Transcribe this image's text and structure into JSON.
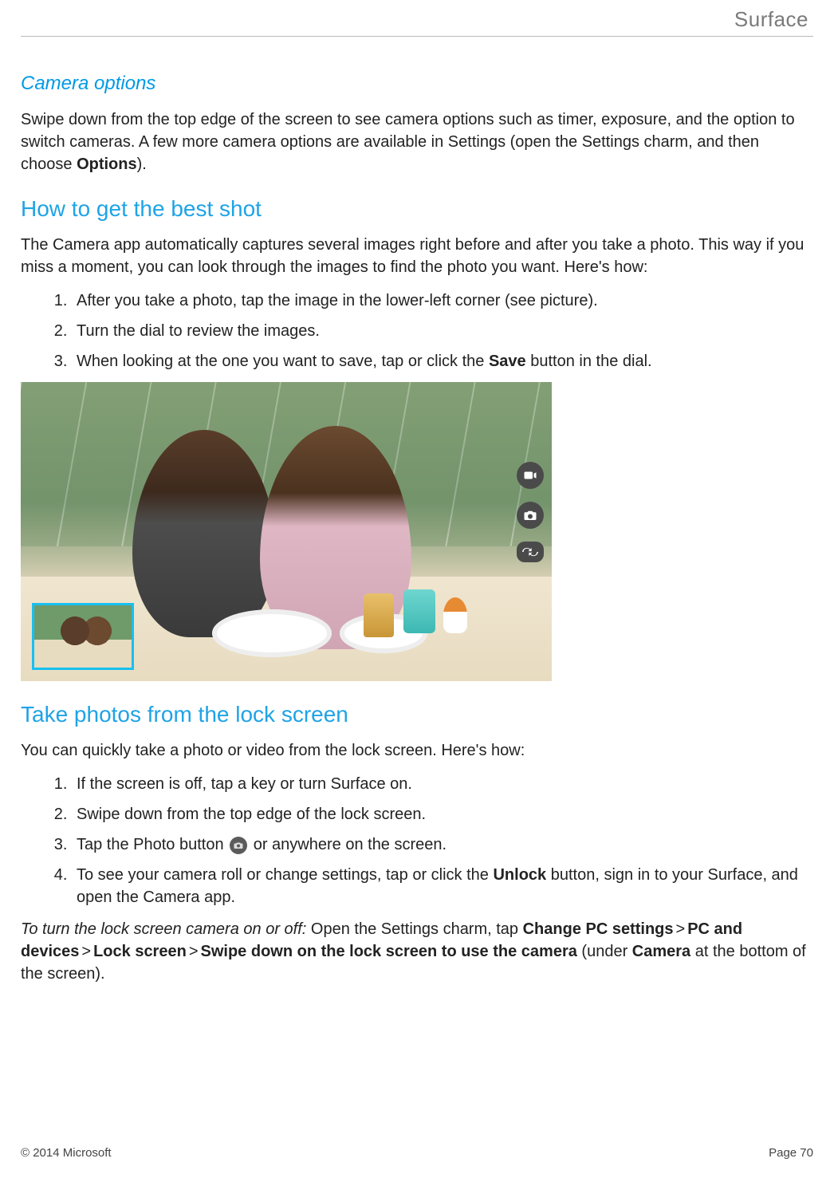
{
  "brand": "Surface",
  "section_camera_options": {
    "title": "Camera options",
    "p1_a": "Swipe down from the top edge of the screen to see camera options such as timer, exposure, and the option to switch cameras. A few more camera options are available in Settings (open the Settings charm, and then choose ",
    "p1_bold": "Options",
    "p1_b": ")."
  },
  "section_best_shot": {
    "title": "How to get the best shot",
    "intro": "The Camera app automatically captures several images right before and after you take a photo. This way if you miss a moment, you can look through the images to find the photo you want. Here's how:",
    "steps": [
      "After you take a photo, tap the image in the lower-left corner (see picture).",
      "Turn the dial to review the images."
    ],
    "step3_a": "When looking at the one you want to save, tap or click the ",
    "step3_bold": "Save",
    "step3_b": " button in the dial."
  },
  "section_lock_screen": {
    "title": "Take photos from the lock screen",
    "intro": "You can quickly take a photo or video from the lock screen. Here's how:",
    "step1": "If the screen is off, tap a key or turn Surface on.",
    "step2": "Swipe down from the top edge of the lock screen.",
    "step3_a": "Tap the Photo button ",
    "step3_b": " or anywhere on the screen.",
    "step4_a": "To see your camera roll or change settings, tap or click the ",
    "step4_bold": "Unlock",
    "step4_b": " button, sign in to your Surface, and open the Camera app.",
    "toggle_lead_italic": "To turn the lock screen camera on or off:",
    "toggle_a": " Open the Settings charm, tap ",
    "toggle_b1": "Change PC settings",
    "toggle_b2": "PC and devices",
    "toggle_b3": "Lock screen",
    "toggle_b4": "Swipe down on the lock screen to use the camera",
    "toggle_c1": " (under ",
    "toggle_c_bold": "Camera",
    "toggle_c2": " at the bottom of the screen).",
    "gt": ">"
  },
  "footer": {
    "copyright": "© 2014 Microsoft",
    "page": "Page 70"
  }
}
